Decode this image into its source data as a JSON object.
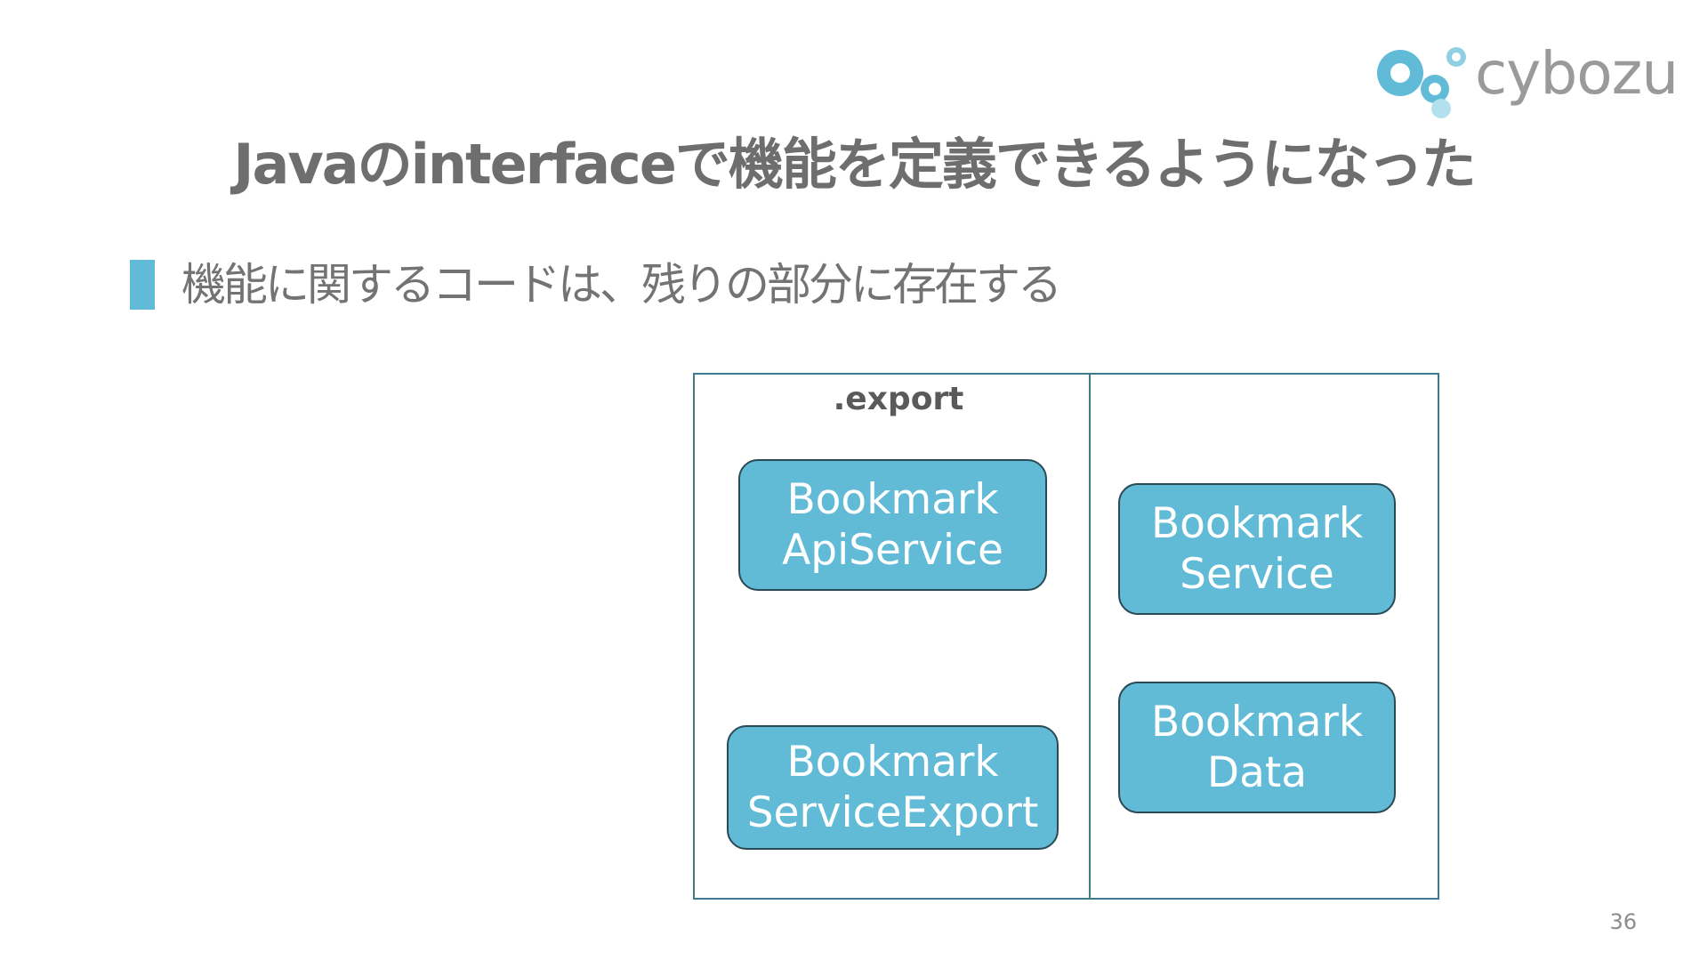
{
  "logo": {
    "text": "cybozu"
  },
  "title": "Javaのinterfaceで機能を定義できるようになった",
  "bullet": {
    "text": "機能に関するコードは、残りの部分に存在する"
  },
  "diagram": {
    "package_label": ".export",
    "nodes": [
      {
        "line1": "Bookmark",
        "line2": "ApiService"
      },
      {
        "line1": "Bookmark",
        "line2": "ServiceExport"
      },
      {
        "line1": "Bookmark",
        "line2": "Service"
      },
      {
        "line1": "Bookmark",
        "line2": "Data"
      }
    ]
  },
  "page_number": "36",
  "colors": {
    "accent": "#62bbd6",
    "node_border": "#2a4a56",
    "frame": "#3d7a8c",
    "title": "#6e6e6e",
    "text": "#737373"
  }
}
